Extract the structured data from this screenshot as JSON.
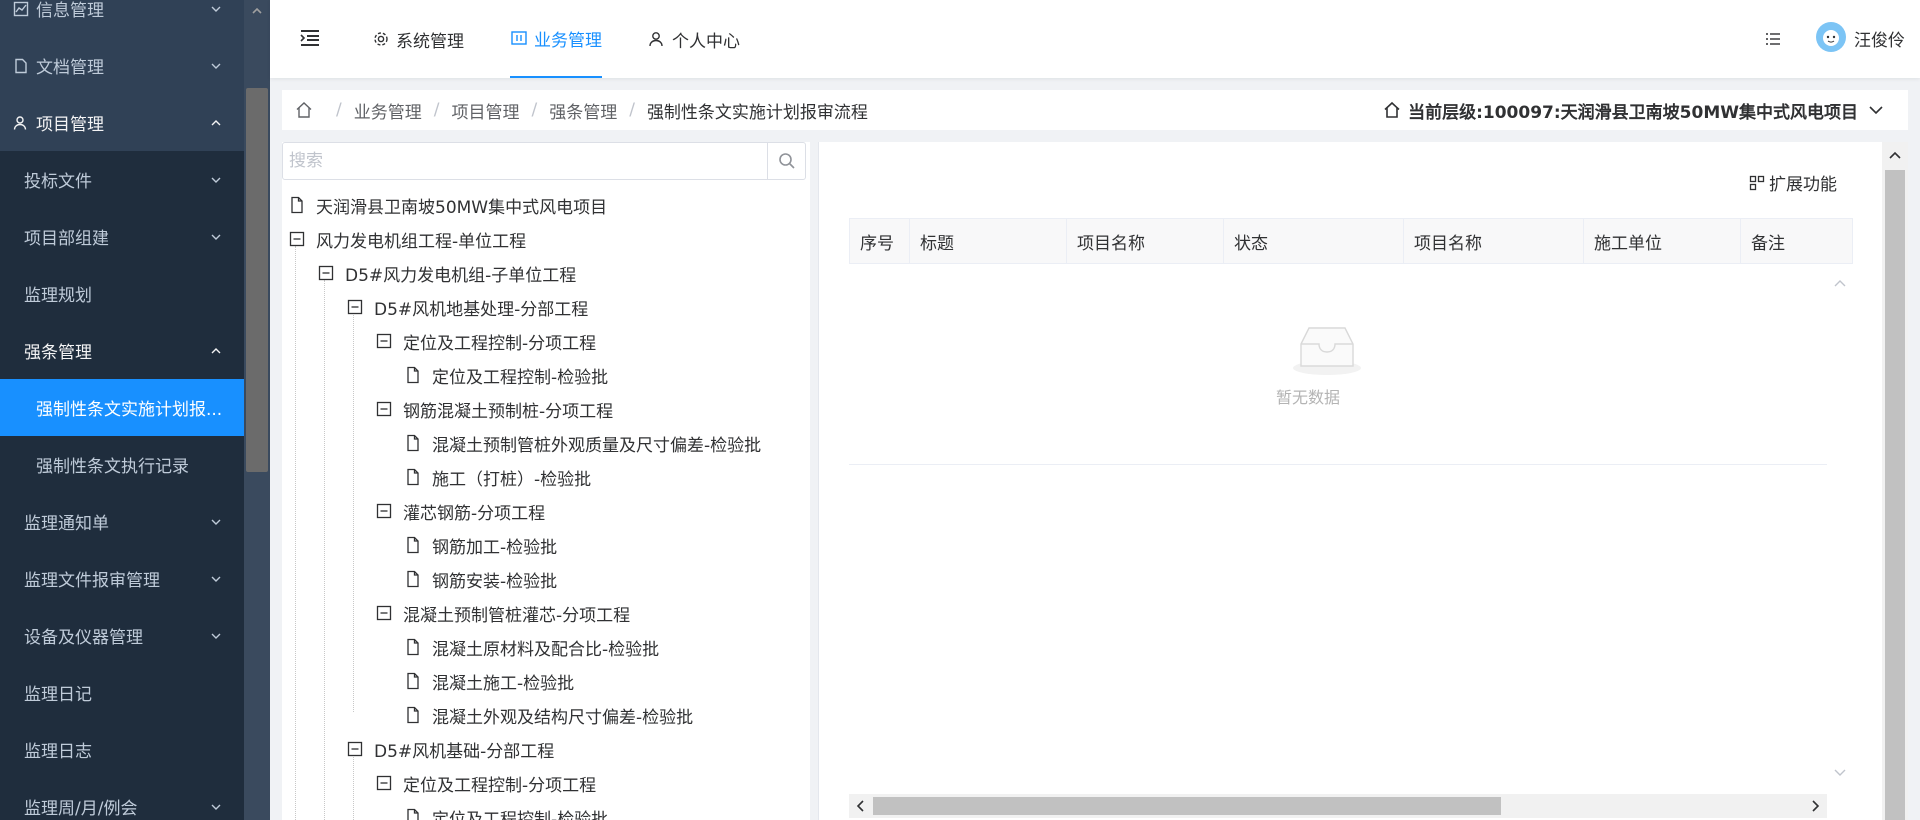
{
  "sidebar": {
    "items": [
      {
        "label": "信息管理"
      },
      {
        "label": "文档管理"
      },
      {
        "label": "项目管理"
      },
      {
        "label": "投标文件"
      },
      {
        "label": "项目部组建"
      },
      {
        "label": "监理规划"
      },
      {
        "label": "强条管理"
      },
      {
        "label": "强制性条文实施计划报..."
      },
      {
        "label": "强制性条文执行记录"
      },
      {
        "label": "监理通知单"
      },
      {
        "label": "监理文件报审管理"
      },
      {
        "label": "设备及仪器管理"
      },
      {
        "label": "监理日记"
      },
      {
        "label": "监理日志"
      },
      {
        "label": "监理周/月/例会"
      }
    ]
  },
  "header": {
    "tabs": [
      {
        "label": "系统管理",
        "icon": "gear-icon"
      },
      {
        "label": "业务管理",
        "icon": "business-icon",
        "active": true
      },
      {
        "label": "个人中心",
        "icon": "user-icon"
      }
    ],
    "username": "汪俊伶"
  },
  "breadcrumb": {
    "items": [
      "业务管理",
      "项目管理",
      "强条管理",
      "强制性条文实施计划报审流程"
    ],
    "separator": "/",
    "level": "当前层级:100097:天润滑县卫南坡50MW集中式风电项目"
  },
  "tree": {
    "search_placeholder": "搜索",
    "nodes": [
      {
        "label": "天润滑县卫南坡50MW集中式风电项目",
        "type": "leaf"
      },
      {
        "label": "风力发电机组工程-单位工程",
        "type": "expanded"
      },
      {
        "label": "D5#风力发电机组-子单位工程",
        "type": "expanded"
      },
      {
        "label": "D5#风机地基处理-分部工程",
        "type": "expanded"
      },
      {
        "label": "定位及工程控制-分项工程",
        "type": "expanded"
      },
      {
        "label": "定位及工程控制-检验批",
        "type": "leaf"
      },
      {
        "label": "钢筋混凝土预制桩-分项工程",
        "type": "expanded"
      },
      {
        "label": "混凝土预制管桩外观质量及尺寸偏差-检验批",
        "type": "leaf"
      },
      {
        "label": "施工（打桩）-检验批",
        "type": "leaf"
      },
      {
        "label": "灌芯钢筋-分项工程",
        "type": "expanded"
      },
      {
        "label": "钢筋加工-检验批",
        "type": "leaf"
      },
      {
        "label": "钢筋安装-检验批",
        "type": "leaf"
      },
      {
        "label": "混凝土预制管桩灌芯-分项工程",
        "type": "expanded"
      },
      {
        "label": "混凝土原材料及配合比-检验批",
        "type": "leaf"
      },
      {
        "label": "混凝土施工-检验批",
        "type": "leaf"
      },
      {
        "label": "混凝土外观及结构尺寸偏差-检验批",
        "type": "leaf"
      },
      {
        "label": "D5#风机基础-分部工程",
        "type": "expanded"
      },
      {
        "label": "定位及工程控制-分项工程",
        "type": "expanded"
      },
      {
        "label": "定位及工程控制-检验批",
        "type": "leaf"
      }
    ]
  },
  "main": {
    "ext_label": "扩展功能",
    "columns": [
      "序号",
      "标题",
      "项目名称",
      "状态",
      "项目名称",
      "施工单位",
      "备注"
    ],
    "empty_text": "暂无数据"
  },
  "colors": {
    "sidebar_bg": "#304156",
    "accent": "#1890ff",
    "sidebar_text": "#bfcbd9"
  }
}
